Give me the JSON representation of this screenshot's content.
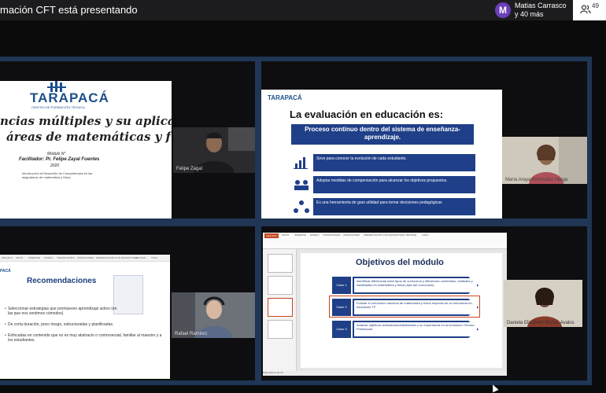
{
  "topbar": {
    "presenting_text": "mación CFT está presentando",
    "avatar_letter": "M",
    "participant_name": "Matias Carrasco",
    "participant_more": "y 40 más",
    "people_count": "49"
  },
  "tiles": [
    {
      "slide": {
        "logo": "TARAPACÁ",
        "institution": "CENTRO DE FORMACIÓN TÉCNICA",
        "title_line1": "ncias múltiples y su aplicación",
        "title_line2": "áreas de matemáticas y física",
        "module": "Módulo N°",
        "facilitator": "Facilitador: Pr. Felipe Zayal Fuentes",
        "year": "2020",
        "footnote": "Introducción al Desarrollo de Competencias en las asignaturas de matemática y física"
      },
      "camera_label": "Felipe Zagal"
    },
    {
      "slide": {
        "logo": "TARAPACÁ",
        "title": "La evaluación en educación es:",
        "banner": "Proceso continuo dentro del sistema de enseñanza-aprendizaje.",
        "rows": [
          {
            "icon": "chart-icon",
            "text": "Sirve para conocer la evolución de cada estudiante."
          },
          {
            "icon": "people-icon",
            "text": "Adoptar medidas de compensación para alcanzar los objetivos propuestos."
          },
          {
            "icon": "network-icon",
            "text": "Es una herramienta de gran utilidad para tomar decisiones pedagógicas"
          }
        ]
      },
      "camera_label": "María Araya Bermúdez Aliaga"
    },
    {
      "slide": {
        "ribbon": [
          "ARCHIVO",
          "INICIO",
          "INSERTAR",
          "DISEÑO",
          "TRANSICIONES",
          "ANIMACIONES",
          "PRESENTACIÓN CON DIAPOSITIVAS",
          "REVISAR",
          "VISTA"
        ],
        "logo": "PACÁ",
        "title": "Recomendaciones",
        "bullets": [
          "Seleccionar estrategias que promueven aprendizaje activo (en las que nos sentimos cómodos).",
          "De corta duración, poco riesgo, estructuradas y planificadas.",
          "Enfocadas en contenido que no es muy abstracto o controversial, familiar al maestro y a los estudiantes."
        ]
      },
      "camera_label": "Rafael Ramirez"
    },
    {
      "slide": {
        "tabs": [
          "ARCHIVO",
          "INICIO",
          "INSERTAR",
          "DISEÑO",
          "TRANSICIONES",
          "ANIMACIONES",
          "PRESENTACIÓN CON DIAPOSITIVAS",
          "REVISAR",
          "VISTA"
        ],
        "title": "Objetivos del módulo",
        "rows": [
          {
            "label": "Clase 1",
            "text": "Identificar diferencias entre tipos de currículum y diferenciar contenidos, actitudes y habilidades en matemática y física (ejes del currículum)."
          },
          {
            "label": "Clase 2",
            "text": "Evaluar el currículum nacional de matemática y física respecto de su relevancia en educación TP"
          },
          {
            "label": "Clase 3",
            "text": "Analizar objetivos actitudinales/habilidades y su importancia en la formación Técnico Profesional."
          }
        ],
        "status": "Diapositiva 3 de 12"
      },
      "camera_label": "Daniela Elizabeth Muñoz Avalos"
    }
  ]
}
